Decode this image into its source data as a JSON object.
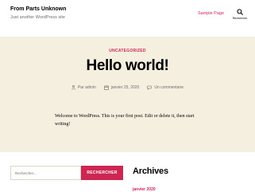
{
  "header": {
    "site_title": "From Parts Unknown",
    "site_description": "Just another WordPress site",
    "nav_link": "Sample Page",
    "search_toggle_label": "Rechercher"
  },
  "post": {
    "category": "UNCATEGORIZED",
    "title": "Hello world!",
    "author": "Par admin",
    "date": "janvier 25, 2020",
    "comments": "Un commentaire",
    "content": "Welcome to WordPress. This is your first post. Edit or delete it, then start writing!"
  },
  "widgets": {
    "search_placeholder": "Rechercher...",
    "search_button": "RECHERCHER",
    "archives_title": "Archives",
    "archive_link": "janvier 2020"
  },
  "colors": {
    "accent": "#cd2653",
    "background": "#f5efe0",
    "header_background": "#ffffff",
    "meta_text": "#6d6d6d"
  }
}
